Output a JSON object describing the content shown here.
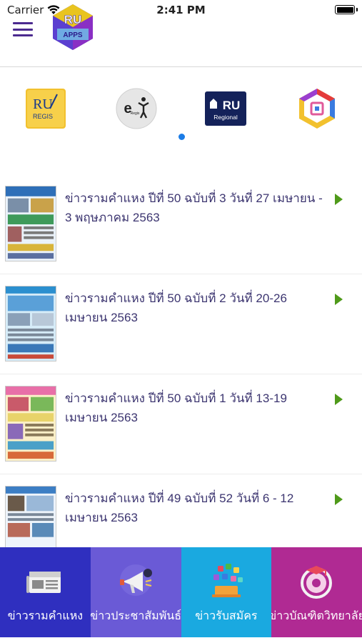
{
  "status_bar": {
    "carrier": "Carrier",
    "time": "2:41 PM"
  },
  "header": {
    "menu_icon": "hamburger-menu-icon",
    "logo_text_top": "RU",
    "logo_text_bottom": "APPS"
  },
  "quick_apps": [
    {
      "icon": "ru-regis-icon",
      "label_top": "RU",
      "label_bottom": "REGIS"
    },
    {
      "icon": "e-regis-icon",
      "label_top": "e",
      "label_bottom": "Regis"
    },
    {
      "icon": "ru-regional-icon",
      "label_top": "RU",
      "label_bottom": "Regional"
    },
    {
      "icon": "hexagon-app-icon"
    }
  ],
  "carousel": {
    "active_page": 1
  },
  "news": [
    {
      "title": "ข่าวรามคำแหง ปีที่ 50 ฉบับที่ 3 วันที่ 27 เมษายน - 3 พฤษภาคม 2563",
      "thumb_color": "#2e6fb8"
    },
    {
      "title": "ข่าวรามคำแหง ปีที่ 50 ฉบับที่ 2 วันที่ 20-26 เมษายน 2563",
      "thumb_color": "#2b8fcf"
    },
    {
      "title": "ข่าวรามคำแหง ปีที่ 50 ฉบับที่ 1 วันที่ 13-19 เมษายน 2563",
      "thumb_color": "#e8d36a"
    },
    {
      "title": "ข่าวรามคำแหง ปีที่ 49 ฉบับที่ 52 วันที่ 6 - 12 เมษายน 2563",
      "thumb_color": "#3c7ec4"
    }
  ],
  "tabs": [
    {
      "label": "ข่าวรามคำแหง",
      "icon": "newspaper-icon",
      "color": "#2f2fbf"
    },
    {
      "label": "ข่าวประชาสัมพันธ์",
      "icon": "megaphone-icon",
      "color": "#6a5ad6"
    },
    {
      "label": "ข่าวรับสมัคร",
      "icon": "apps-cloud-icon",
      "color": "#1aa9e0"
    },
    {
      "label": "ข่าวบัณฑิตวิทยาลัย",
      "icon": "graduate-icon",
      "color": "#b02a93"
    }
  ],
  "colors": {
    "accent_purple": "#4b2a8f",
    "title_text": "#3c3570",
    "chevron_green": "#4f9a1a",
    "page_dot": "#1b7ce6"
  }
}
